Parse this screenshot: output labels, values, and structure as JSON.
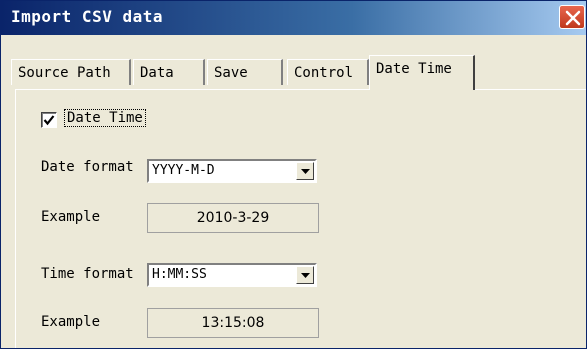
{
  "window": {
    "title": "Import CSV data"
  },
  "tabs": [
    {
      "label": "Source Path"
    },
    {
      "label": "Data"
    },
    {
      "label": "Save"
    },
    {
      "label": "Control"
    },
    {
      "label": "Date Time",
      "active": true
    }
  ],
  "datetime": {
    "checkbox_label": "Date Time",
    "checked": true,
    "date_format_label": "Date format",
    "date_format_value": "YYYY-M-D",
    "date_example_label": "Example",
    "date_example_value": "2010-3-29",
    "time_format_label": "Time format",
    "time_format_value": "H:MM:SS",
    "time_example_label": "Example",
    "time_example_value": "13:15:08"
  },
  "icons": {
    "close": "close-icon",
    "check": "checkmark-icon",
    "dropdown": "chevron-down-icon"
  }
}
